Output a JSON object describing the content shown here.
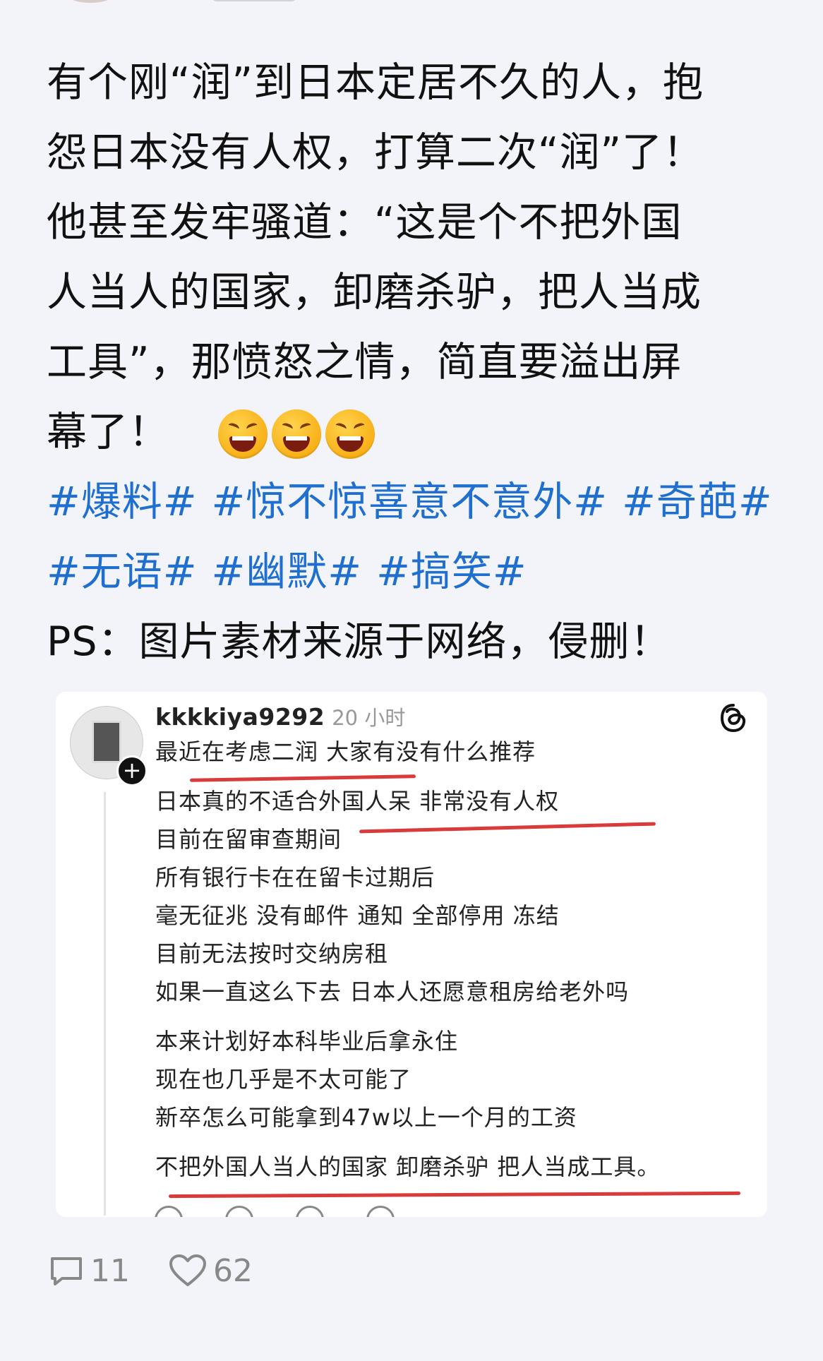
{
  "post": {
    "lines": [
      "有个刚“润”到日本定居不久的人，抱",
      "怨日本没有人权，打算二次“润”了！",
      "他甚至发牢骚道：“这是个不把外国",
      "人当人的国家，卸磨杀驴，把人当成",
      "工具”，那愤怒之情，简直要溢出屏",
      "幕了！"
    ],
    "emojis": [
      "laughing-emoji",
      "laughing-emoji",
      "laughing-emoji"
    ],
    "hashtags_row1": [
      "#爆料#",
      "#惊不惊喜意不意外#",
      "#奇葩#"
    ],
    "hashtags_row2": [
      "#无语#",
      "#幽默#",
      "#搞笑#"
    ],
    "ps": "PS：图片素材来源于网络，侵删！",
    "hashtag_color": "#1f6fd0"
  },
  "card": {
    "username": "kkkkiya9292",
    "time": "20 小时",
    "lines": [
      "最近在考虑二润  大家有没有什么推荐",
      "日本真的不适合外国人呆 非常没有人权",
      "目前在留审查期间",
      "所有银行卡在在留卡过期后",
      "毫无征兆 没有邮件 通知 全部停用 冻结",
      "目前无法按时交纳房租",
      "如果一直这么下去 日本人还愿意租房给老外吗",
      "本来计划好本科毕业后拿永住",
      "现在也几乎是不太可能了",
      "新卒怎么可能拿到47w以上一个月的工资",
      "不把外国人当人的国家 卸磨杀驴 把人当成工具。"
    ],
    "underline_color": "#d93a3a",
    "icon": "threads-icon"
  },
  "footer": {
    "comments": "11",
    "likes": "62"
  }
}
